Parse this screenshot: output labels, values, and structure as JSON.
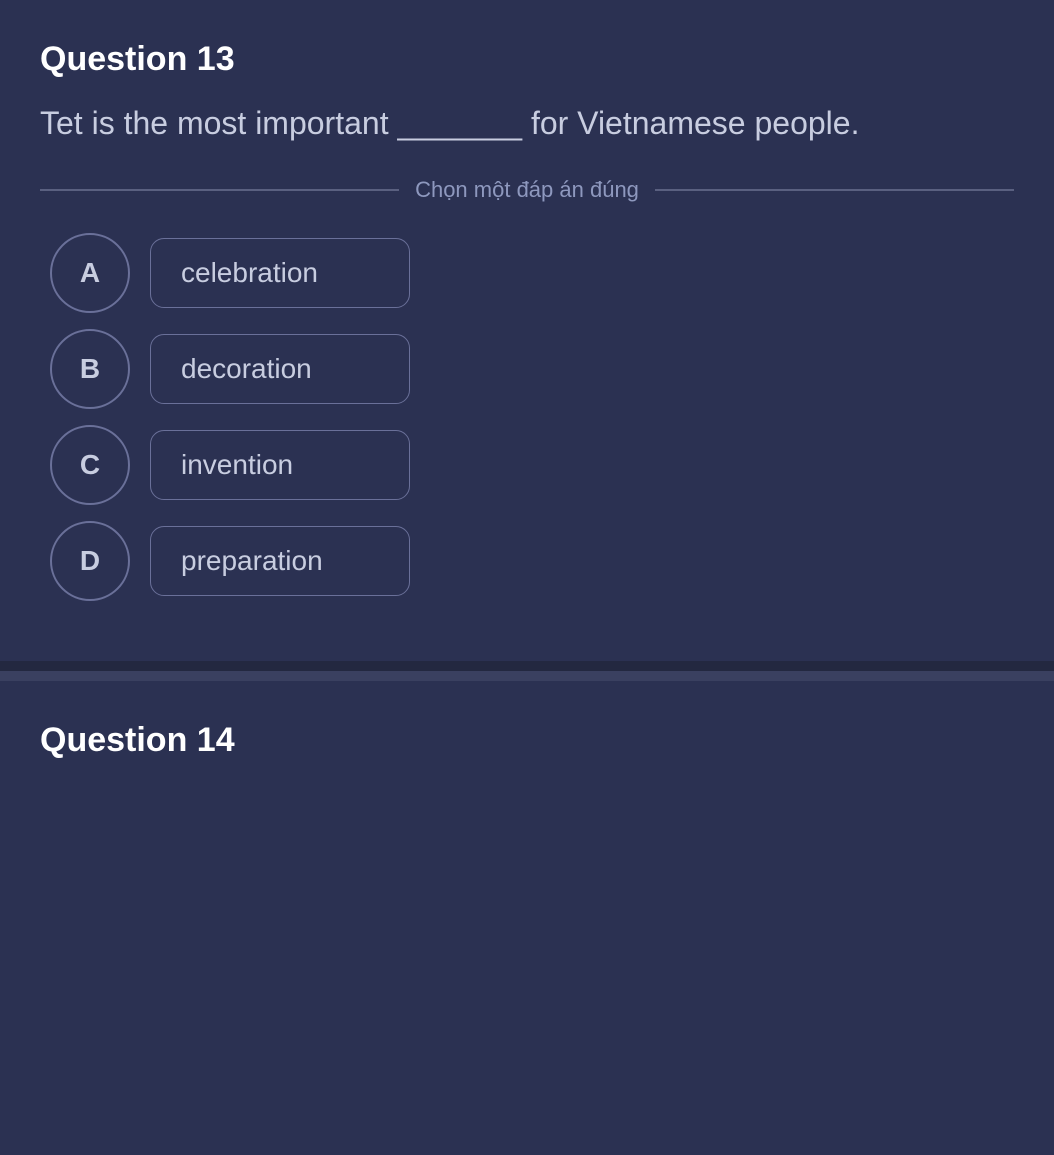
{
  "question13": {
    "title": "Question 13",
    "text": "Tet is the most important _______ for Vietnamese people.",
    "divider_label": "Chọn một đáp án đúng",
    "options": [
      {
        "letter": "A",
        "text": "celebration"
      },
      {
        "letter": "B",
        "text": "decoration"
      },
      {
        "letter": "C",
        "text": "invention"
      },
      {
        "letter": "D",
        "text": "preparation"
      }
    ]
  },
  "question14": {
    "title": "Question 14"
  },
  "colors": {
    "background": "#2b3152",
    "text": "#c8cde0",
    "border": "#6a7099",
    "divider_text": "#8e98be",
    "title": "#ffffff"
  }
}
